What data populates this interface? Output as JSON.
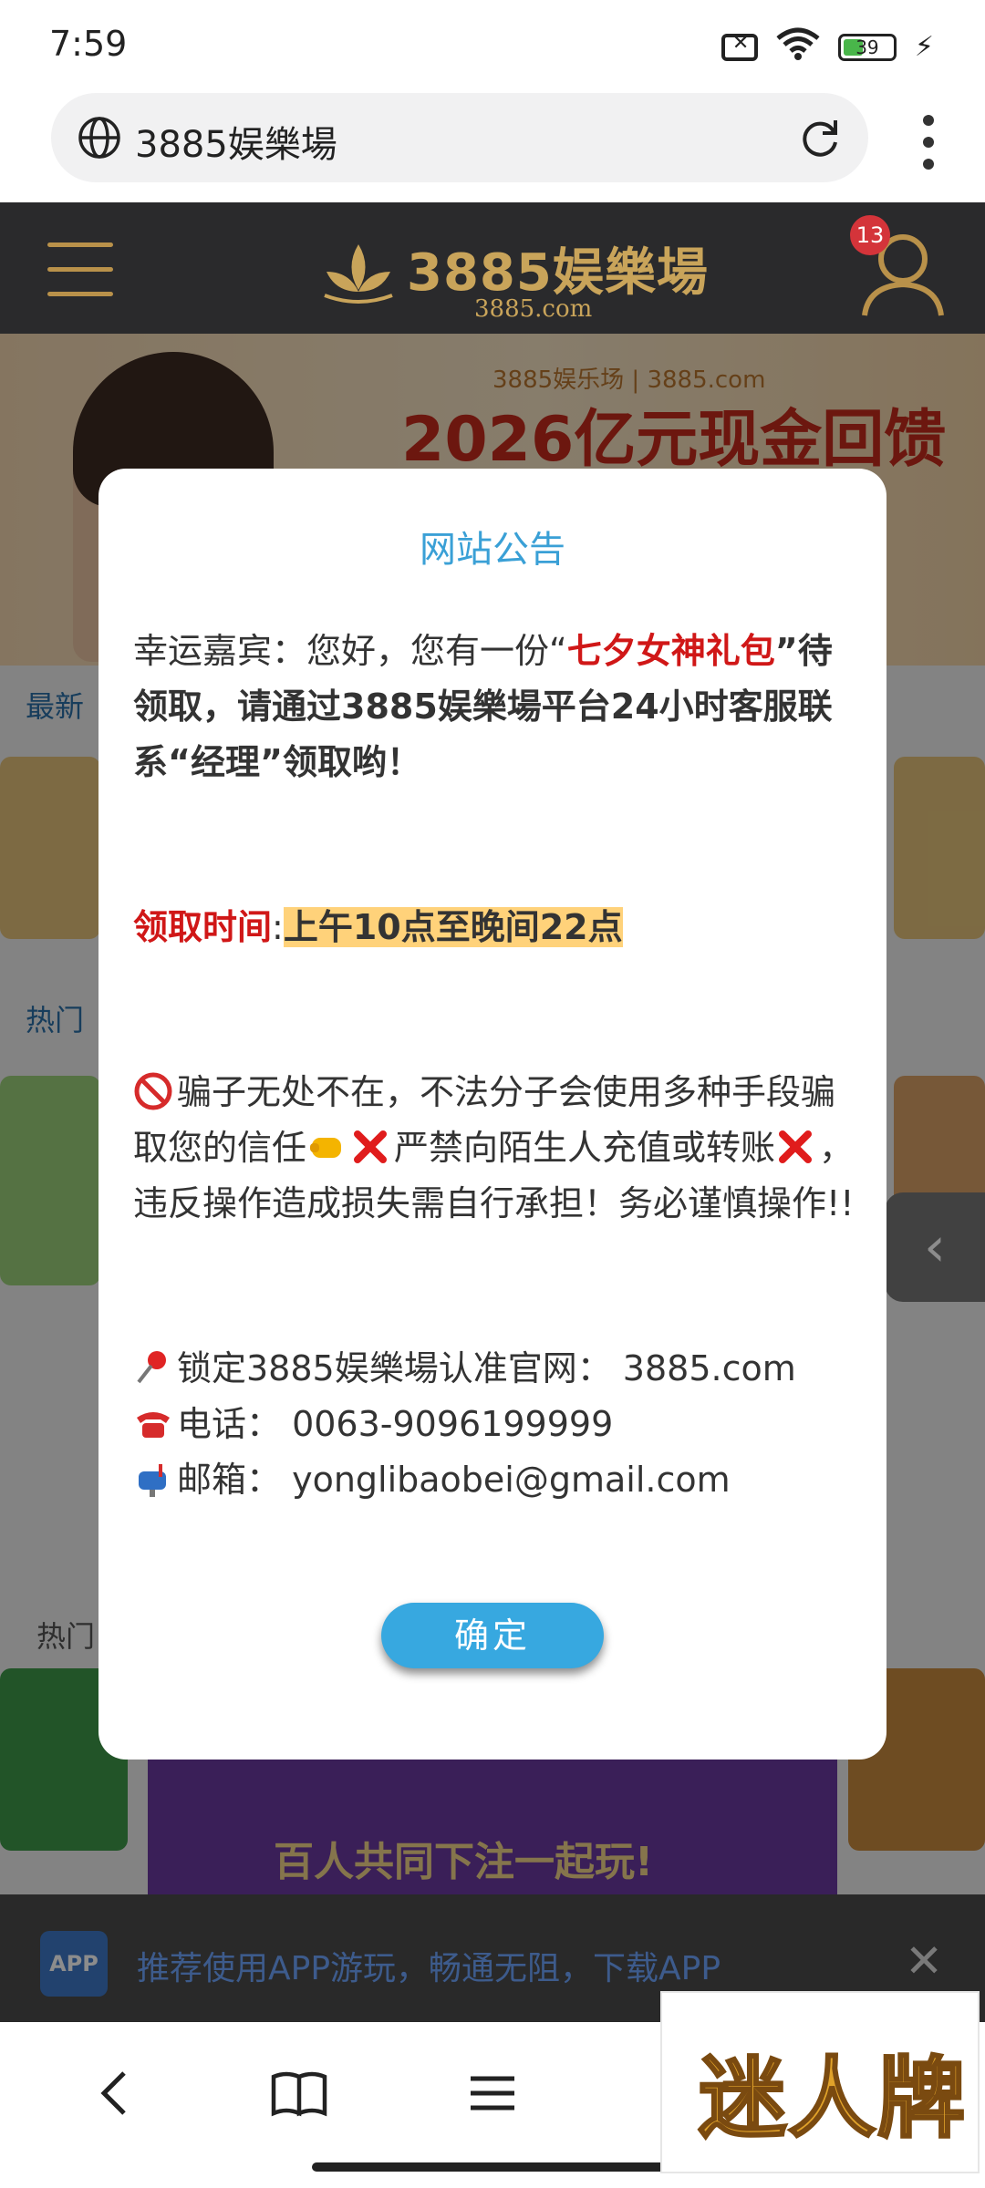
{
  "status_bar": {
    "time": "7:59",
    "battery": "39"
  },
  "browser": {
    "url": "3885娱樂場"
  },
  "site": {
    "logo_name": "3885娱樂場",
    "logo_domain": "3885.com",
    "notification_count": "13"
  },
  "background": {
    "banner_sub": "3885娱乐场 | 3885.com",
    "banner_title": "2026亿元现金回馈",
    "section_latest": "最新",
    "section_hot": "热门",
    "hot_label": "热门",
    "purple_text": "百人共同下注一起玩!"
  },
  "app_prompt": {
    "chip": "APP",
    "text": "推荐使用APP游玩，畅通无阻，下载APP"
  },
  "modal": {
    "title": "网站公告",
    "greeting_prefix": "幸运嘉宾：您好，您有一份“",
    "gift_name": "七夕女神礼包",
    "greeting_suffix": "”待领取，请通过3885娱樂場平台24小时客服联系“经理”领取哟！",
    "time_label": "领取时间",
    "time_sep": ":",
    "time_value": "上午10点至晚间22点",
    "warn_part1": "骗子无处不在，不法分子会使用多种手段骗取您的信任",
    "warn_part2": "严禁向陌生人充值或转账",
    "warn_part3": "，违反操作造成损失需自行承担！务必谨慎操作!!",
    "site_line": "锁定3885娱樂場认准官网：  3885.com",
    "phone_line": "电话：  0063-9096199999",
    "email_line": "邮箱：  yonglibaobei@gmail.com",
    "confirm_button": "确定"
  },
  "watermark": "迷人牌"
}
